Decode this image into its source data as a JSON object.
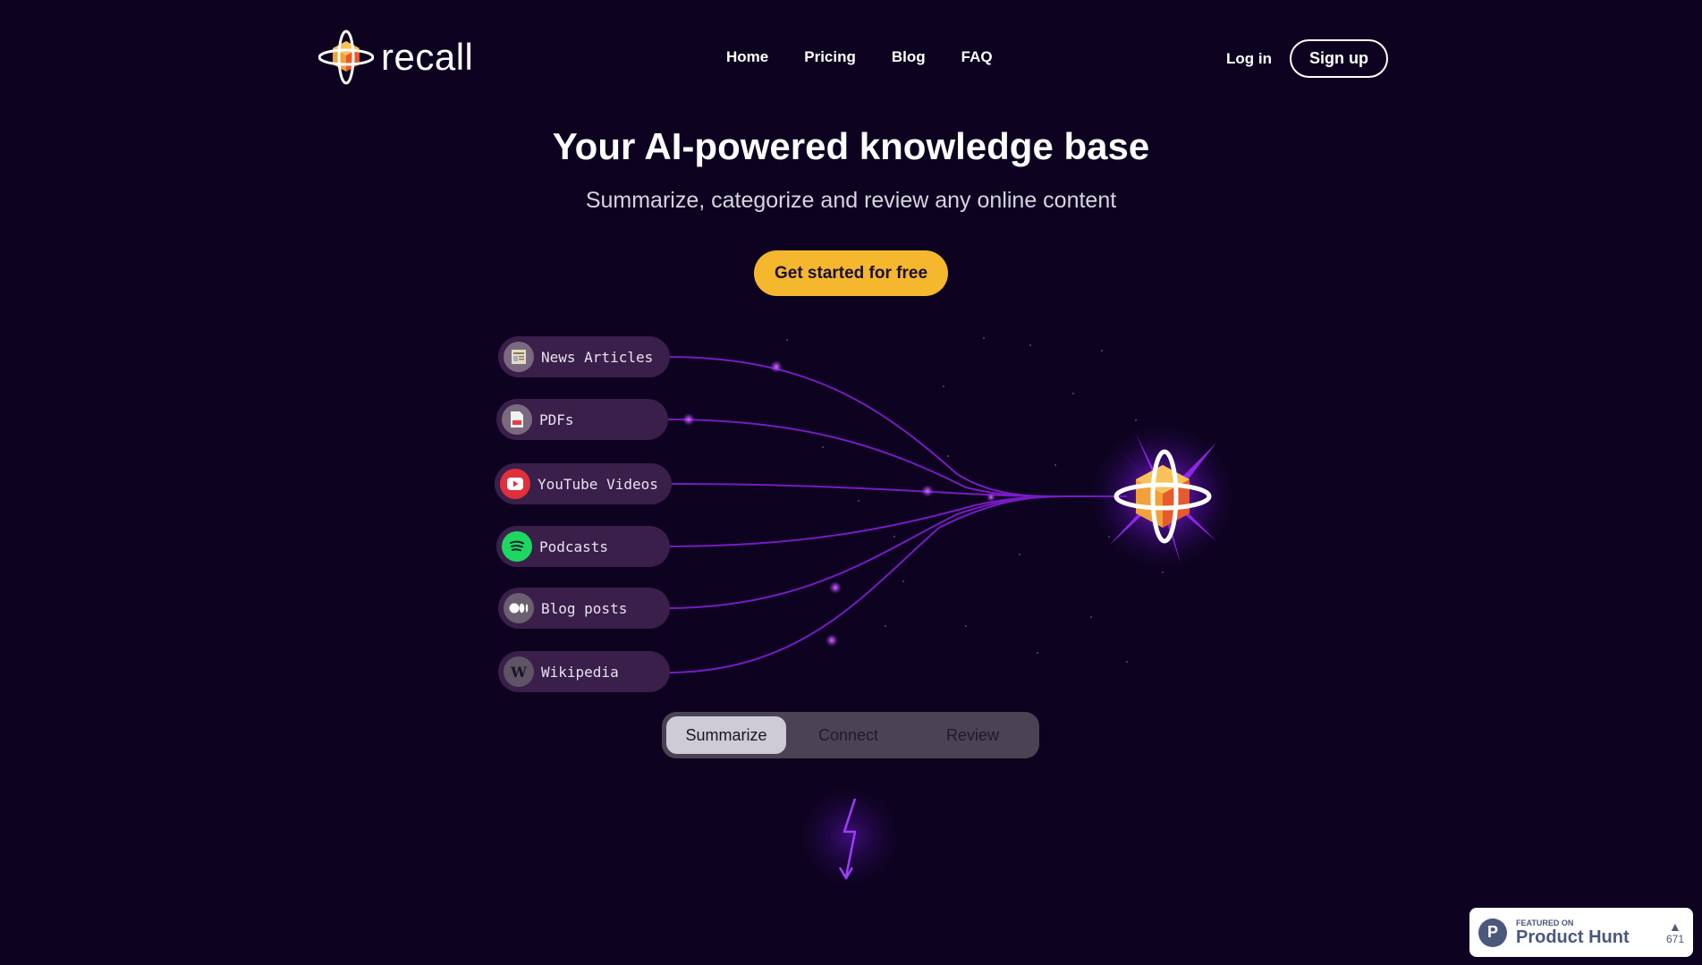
{
  "header": {
    "logo_text": "recall",
    "nav": [
      "Home",
      "Pricing",
      "Blog",
      "FAQ"
    ],
    "login_label": "Log in",
    "signup_label": "Sign up"
  },
  "hero": {
    "title": "Your AI-powered knowledge base",
    "subtitle": "Summarize, categorize and review any online content",
    "cta_label": "Get started for free"
  },
  "sources": [
    {
      "label": "News Articles",
      "icon": "newspaper-icon"
    },
    {
      "label": "PDFs",
      "icon": "pdf-icon"
    },
    {
      "label": "YouTube Videos",
      "icon": "youtube-icon"
    },
    {
      "label": "Podcasts",
      "icon": "spotify-icon"
    },
    {
      "label": "Blog posts",
      "icon": "medium-icon"
    },
    {
      "label": "Wikipedia",
      "icon": "wikipedia-icon"
    }
  ],
  "tabs": [
    "Summarize",
    "Connect",
    "Review"
  ],
  "active_tab": "Summarize",
  "product_hunt": {
    "featured_label": "FEATURED ON",
    "name": "Product Hunt",
    "votes": "671"
  },
  "colors": {
    "background": "#0d0320",
    "accent": "#f4b72d",
    "glow": "#9b2cf5",
    "pill": "#3a1f4a"
  }
}
